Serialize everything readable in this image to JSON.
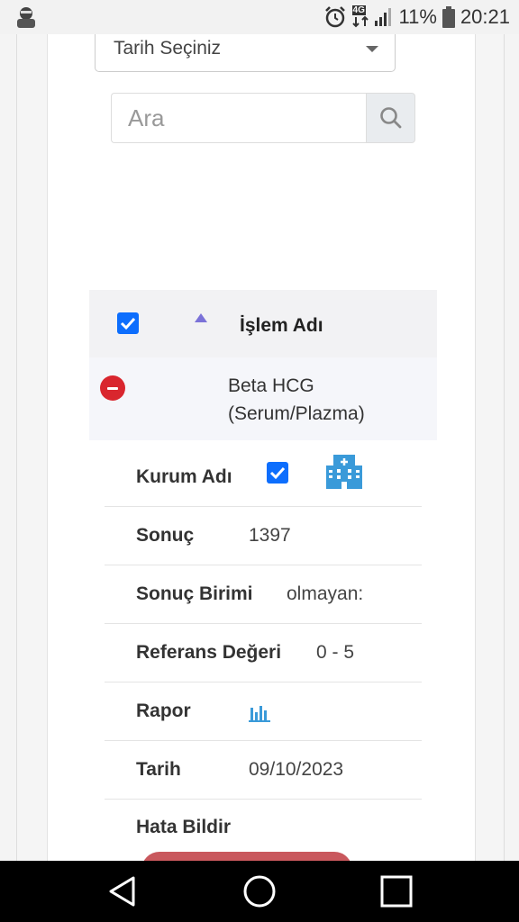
{
  "status_bar": {
    "network": "4G",
    "battery": "11%",
    "time": "20:21"
  },
  "filters": {
    "date_select_value": "Tarih Seçiniz",
    "search_placeholder": "Ara"
  },
  "table": {
    "header_label": "İşlem Adı",
    "row": {
      "name_line1": "Beta HCG",
      "name_line2": "(Serum/Plazma)"
    },
    "details": [
      {
        "label": "Kurum Adı",
        "value": ""
      },
      {
        "label": "Sonuç",
        "value": "1397"
      },
      {
        "label": "Sonuç Birimi",
        "value": "olmayan:"
      },
      {
        "label": "Referans Değeri",
        "value": "0 - 5"
      },
      {
        "label": "Rapor",
        "value": ""
      },
      {
        "label": "Tarih",
        "value": "09/10/2023"
      },
      {
        "label": "Hata Bildir",
        "value": ""
      }
    ]
  },
  "colors": {
    "checkbox": "#0d6efd",
    "remove": "#d9262e",
    "icon_blue": "#3a9ad9",
    "report_button": "#c9585d"
  }
}
